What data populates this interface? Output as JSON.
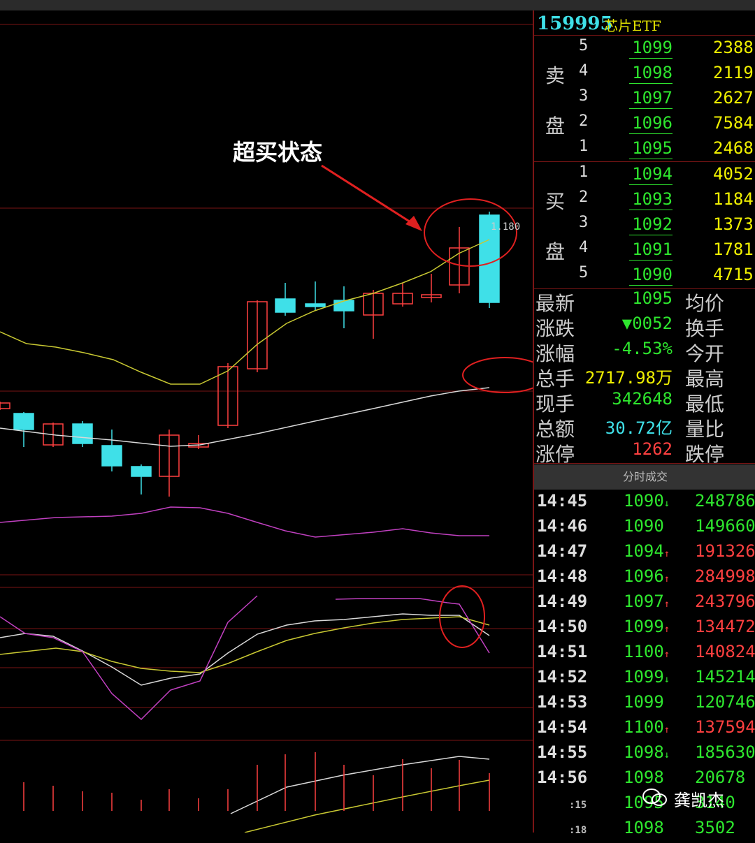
{
  "security": {
    "code": "159995",
    "name": "芯片ETF"
  },
  "annotation": "超买状态",
  "price_tag": "1.180",
  "order_book": {
    "sell_label": [
      "卖",
      "盘"
    ],
    "buy_label": [
      "买",
      "盘"
    ],
    "sell": [
      {
        "level": "5",
        "price": "1099",
        "vol": "2388"
      },
      {
        "level": "4",
        "price": "1098",
        "vol": "2119"
      },
      {
        "level": "3",
        "price": "1097",
        "vol": "2627"
      },
      {
        "level": "2",
        "price": "1096",
        "vol": "7584"
      },
      {
        "level": "1",
        "price": "1095",
        "vol": "2468"
      }
    ],
    "buy": [
      {
        "level": "1",
        "price": "1094",
        "vol": "4052"
      },
      {
        "level": "2",
        "price": "1093",
        "vol": "1184"
      },
      {
        "level": "3",
        "price": "1092",
        "vol": "1373"
      },
      {
        "level": "4",
        "price": "1091",
        "vol": "1781"
      },
      {
        "level": "5",
        "price": "1090",
        "vol": "4715"
      }
    ]
  },
  "quote": [
    {
      "label": "最新",
      "value": "1095",
      "color": "#2ee62e",
      "label2": "均价"
    },
    {
      "label": "涨跌",
      "value": "▼0052",
      "color": "#2ee62e",
      "label2": "换手"
    },
    {
      "label": "涨幅",
      "value": "-4.53%",
      "color": "#2ee62e",
      "label2": "今开"
    },
    {
      "label": "总手",
      "value": "2717.98万",
      "color": "#f0f000",
      "label2": "最高"
    },
    {
      "label": "现手",
      "value": "342648",
      "color": "#2ee62e",
      "label2": "最低"
    },
    {
      "label": "总额",
      "value": "30.72亿",
      "color": "#3fe0e8",
      "label2": "量比"
    },
    {
      "label": "涨停",
      "value": "1262",
      "color": "#ff4040",
      "label2": "跌停"
    }
  ],
  "ticks_header": "分时成交",
  "ticks": [
    {
      "time": "14:45",
      "price": "1090",
      "arrow": "↓",
      "vol": "248786",
      "vcolor": "#2ee62e"
    },
    {
      "time": "14:46",
      "price": "1090",
      "arrow": "",
      "vol": "149660",
      "vcolor": "#2ee62e"
    },
    {
      "time": "14:47",
      "price": "1094",
      "arrow": "↑",
      "vol": "191326",
      "vcolor": "#ff4040"
    },
    {
      "time": "14:48",
      "price": "1096",
      "arrow": "↑",
      "vol": "284998",
      "vcolor": "#ff4040"
    },
    {
      "time": "14:49",
      "price": "1097",
      "arrow": "↑",
      "vol": "243796",
      "vcolor": "#ff4040"
    },
    {
      "time": "14:50",
      "price": "1099",
      "arrow": "↑",
      "vol": "134472",
      "vcolor": "#ff4040"
    },
    {
      "time": "14:51",
      "price": "1100",
      "arrow": "↑",
      "vol": "140824",
      "vcolor": "#ff4040"
    },
    {
      "time": "14:52",
      "price": "1099",
      "arrow": "↓",
      "vol": "145214",
      "vcolor": "#2ee62e"
    },
    {
      "time": "14:53",
      "price": "1099",
      "arrow": "",
      "vol": "120746",
      "vcolor": "#2ee62e"
    },
    {
      "time": "14:54",
      "price": "1100",
      "arrow": "↑",
      "vol": "137594",
      "vcolor": "#ff4040"
    },
    {
      "time": "14:55",
      "price": "1098",
      "arrow": "↓",
      "vol": "185630",
      "vcolor": "#2ee62e"
    },
    {
      "time": "14:56",
      "price": "1098",
      "arrow": "",
      "vol": "20678",
      "vcolor": "#2ee62e"
    },
    {
      "time": ":15",
      "price": "1095",
      "arrow": "",
      "vol": "3140",
      "vcolor": "#2ee62e"
    },
    {
      "time": ":18",
      "price": "1098",
      "arrow": "",
      "vol": "3502",
      "vcolor": "#2ee62e"
    }
  ],
  "watermark": "龚凯杰",
  "colors": {
    "up": "#ff4040",
    "down": "#3fe0e8",
    "grid": "#7a1515",
    "ma_yellow": "#c8c832",
    "ma_white": "#d8d8d8",
    "purple": "#c040c0"
  }
}
